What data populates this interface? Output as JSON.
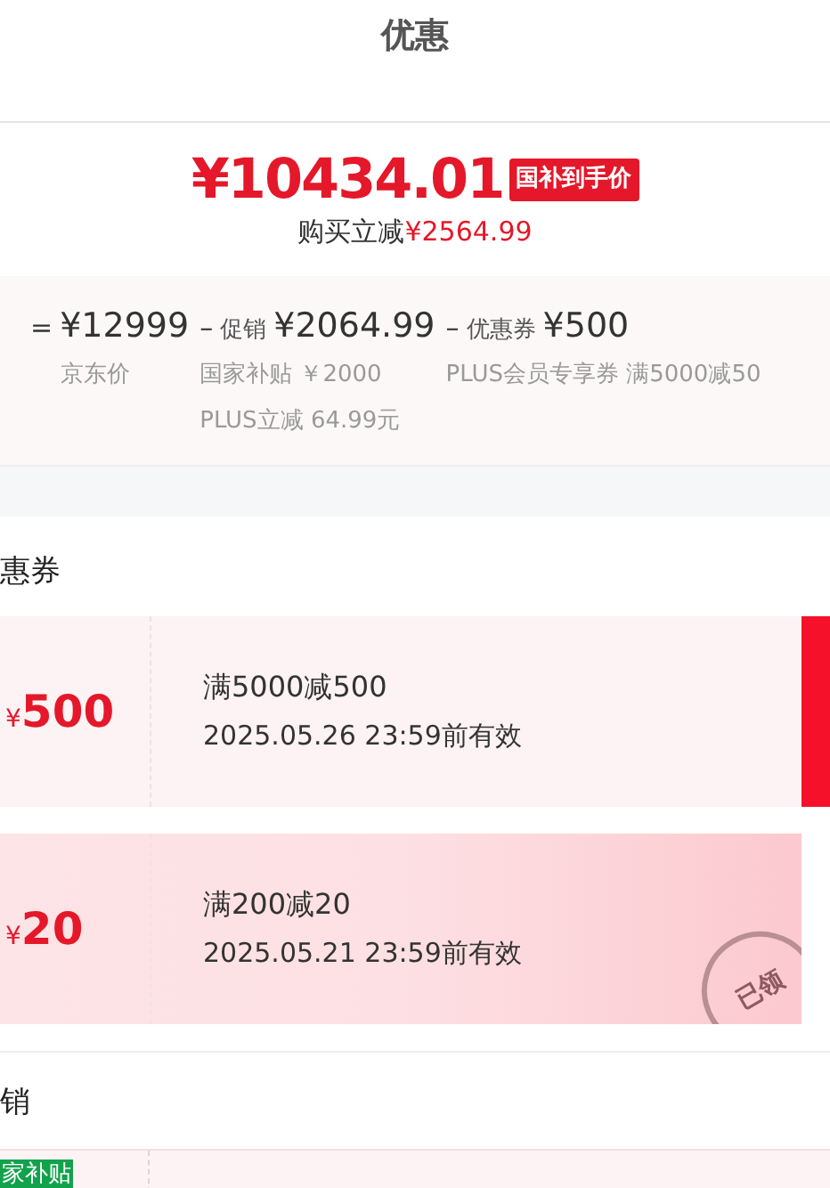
{
  "title": "优惠",
  "price": {
    "amount": "¥10434.01",
    "badge": "国补到手价",
    "saving_label": "购买立减",
    "saving": "¥2564.99"
  },
  "breakdown": [
    {
      "op": "=",
      "value": "¥12999",
      "notes": [
        "京东价"
      ]
    },
    {
      "op": "–",
      "label": "促销",
      "value": "¥2064.99",
      "notes": [
        "国家补贴 ￥2000",
        "PLUS立减 64.99元"
      ]
    },
    {
      "op": "–",
      "label": "优惠券",
      "value": "¥500",
      "notes": [
        "PLUS会员专享券 满5000减50"
      ]
    }
  ],
  "coupons_section": {
    "heading": "惠券",
    "coupons": [
      {
        "currency": "¥",
        "amount": "500",
        "rule": "满5000减500",
        "expiry": "2025.05.26 23:59前有效",
        "claimed": false
      },
      {
        "currency": "¥",
        "amount": "20",
        "rule": "满200减20",
        "expiry": "2025.05.21 23:59前有效",
        "claimed": true,
        "stamp": "已领"
      }
    ]
  },
  "promo_section": {
    "heading": "销",
    "tag": "家补贴"
  }
}
